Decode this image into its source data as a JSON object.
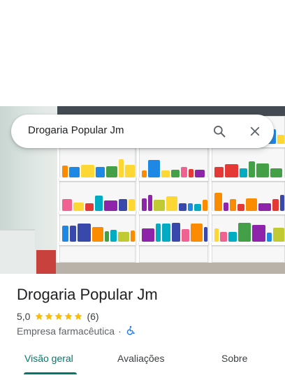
{
  "search": {
    "query": "Drogaria Popular Jm",
    "search_icon": "search-icon",
    "close_icon": "close-icon"
  },
  "hero": {
    "image_icon": "pharmacy-shelves-photo"
  },
  "place": {
    "title": "Drogaria Popular Jm",
    "rating_value": "5,0",
    "rating_stars": 5,
    "review_count": "(6)",
    "category": "Empresa farmacêutica",
    "separator": "·",
    "accessibility_icon": "wheelchair-accessible-icon"
  },
  "tabs": {
    "items": [
      {
        "label": "Visão geral",
        "active": true
      },
      {
        "label": "Avaliações",
        "active": false
      },
      {
        "label": "Sobre",
        "active": false
      }
    ]
  },
  "colors": {
    "accent": "#00796b",
    "star": "#fbbc04",
    "accessibility": "#1a73e8"
  }
}
